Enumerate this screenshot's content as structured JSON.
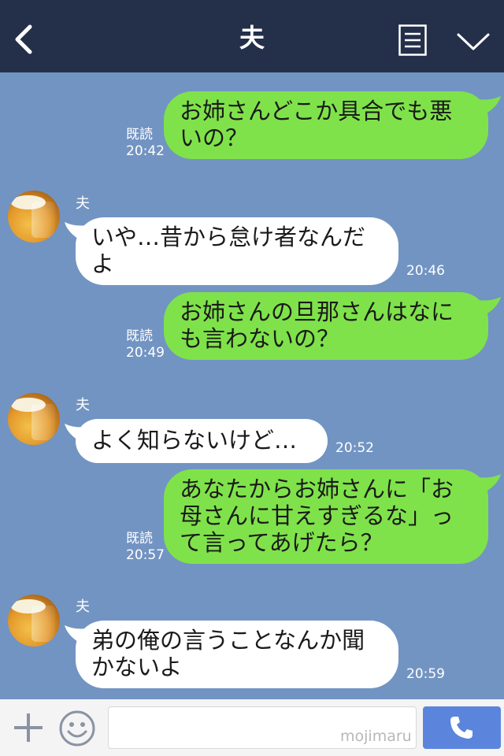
{
  "header": {
    "title": "夫",
    "back_icon": "chevron-left-icon",
    "menu_icon": "list-icon",
    "more_icon": "chevron-down-icon"
  },
  "messages": [
    {
      "side": "sent",
      "text": "お姉さんどこか具合でも悪\nいの？",
      "read": "既読",
      "time": "20:42"
    },
    {
      "side": "received",
      "sender": "夫",
      "text": "いや…昔から怠け者なんだ\nよ",
      "time": "20:46"
    },
    {
      "side": "sent",
      "text": "お姉さんの旦那さんはなに\nも言わないの？",
      "read": "既読",
      "time": "20:49"
    },
    {
      "side": "received",
      "sender": "夫",
      "text": "よく知らないけど…",
      "time": "20:52"
    },
    {
      "side": "sent",
      "text": "あなたからお姉さんに「お\n母さんに甘えすぎるな」っ\nて言ってあげたら？",
      "read": "既読",
      "time": "20:57"
    },
    {
      "side": "received",
      "sender": "夫",
      "text": "弟の俺の言うことなんか聞\nかないよ",
      "time": "20:59"
    }
  ],
  "input_bar": {
    "plus_icon": "plus-icon",
    "sticker_icon": "smiley-icon",
    "input_value": "",
    "watermark": "mojimaru",
    "call_icon": "phone-icon"
  },
  "colors": {
    "header_bg": "#24304a",
    "chat_bg": "#7294c2",
    "sent_bubble": "#7fe24a",
    "received_bubble": "#ffffff",
    "call_button": "#5b85dc"
  }
}
